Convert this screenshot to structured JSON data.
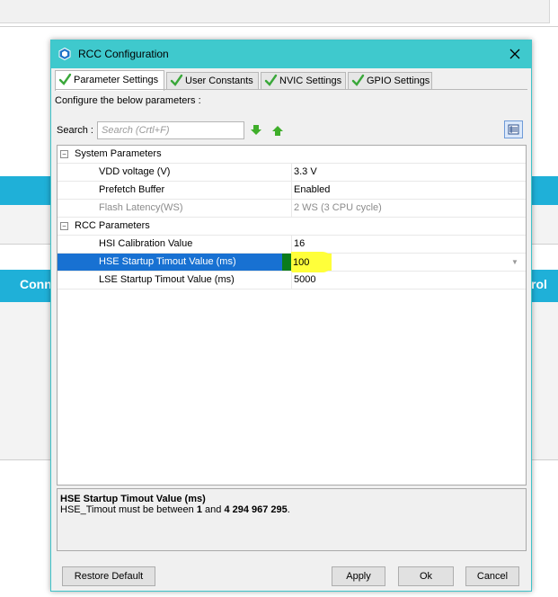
{
  "background": {
    "left_header": "Conn",
    "right_header": "rol"
  },
  "dialog": {
    "title": "RCC Configuration",
    "tabs": [
      {
        "label": "Parameter Settings",
        "active": true
      },
      {
        "label": "User Constants",
        "active": false
      },
      {
        "label": "NVIC Settings",
        "active": false
      },
      {
        "label": "GPIO Settings",
        "active": false
      }
    ],
    "configure_text": "Configure the below parameters :",
    "search": {
      "label": "Search :",
      "placeholder": "Search (Crtl+F)"
    },
    "groups": [
      {
        "name": "System Parameters",
        "toggle": "−",
        "params": [
          {
            "name": "VDD voltage (V)",
            "value": "3.3 V"
          },
          {
            "name": "Prefetch Buffer",
            "value": "Enabled"
          },
          {
            "name": "Flash Latency(WS)",
            "value": "2 WS (3 CPU cycle)",
            "disabled": true
          }
        ]
      },
      {
        "name": "RCC Parameters",
        "toggle": "−",
        "params": [
          {
            "name": "HSI Calibration Value",
            "value": "16"
          },
          {
            "name": "HSE Startup Timout Value (ms)",
            "value": "100",
            "selected": true
          },
          {
            "name": "LSE Startup Timout Value (ms)",
            "value": "5000"
          }
        ]
      }
    ],
    "description": {
      "title": "HSE Startup Timout Value (ms)",
      "text_prefix": "HSE_Timout must be between ",
      "min": "1",
      "text_mid": " and ",
      "max": "4 294 967 295",
      "text_suffix": "."
    },
    "buttons": {
      "restore_default": "Restore Default",
      "apply": "Apply",
      "ok": "Ok",
      "cancel": "Cancel"
    },
    "colors": {
      "titlebar": "#3fc9cd",
      "selection": "#1871d2",
      "edit_highlight": "#ffff3a",
      "check": "#3aa83a"
    }
  }
}
